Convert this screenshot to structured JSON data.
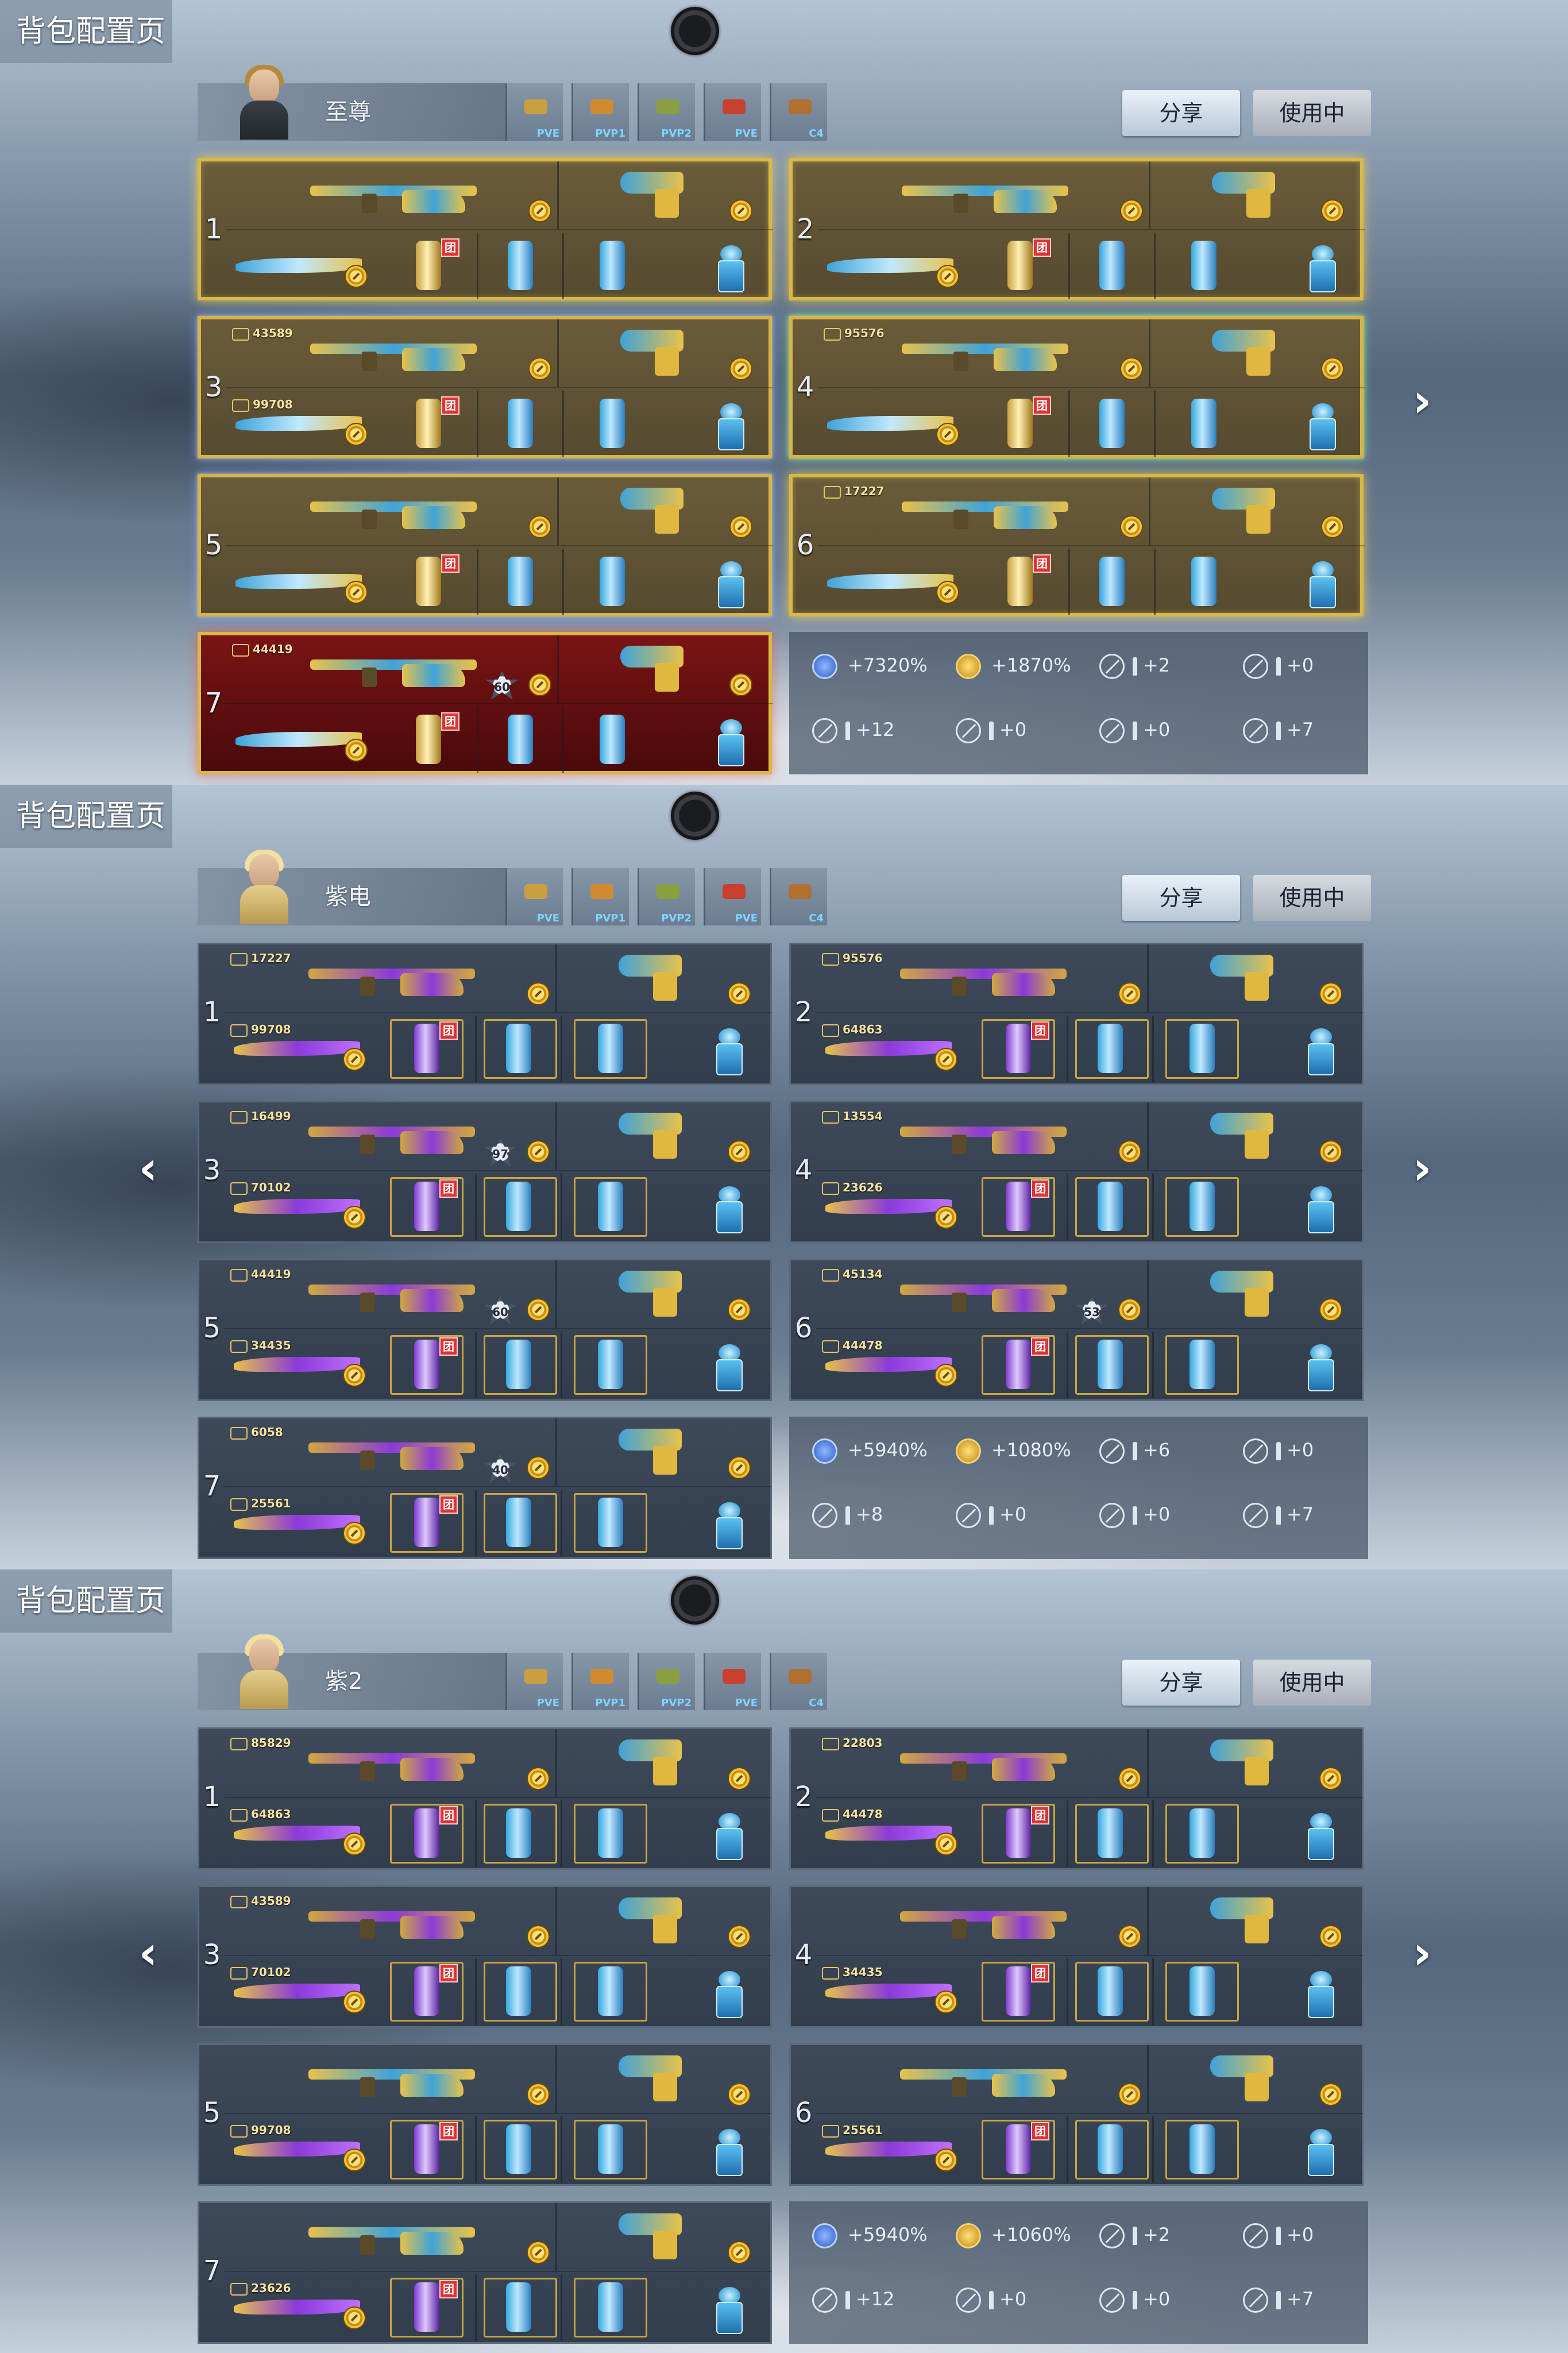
{
  "colors": {
    "gold": "#d9b843",
    "blue_accent": "#36a8e0",
    "purple": "#7e3bd0",
    "team_red": "#dd3333"
  },
  "pages": [
    {
      "title": "背包配置页",
      "loadout_name": "至尊",
      "modes": [
        {
          "label": "PVE",
          "icon": "pve-icon"
        },
        {
          "label": "PVP1",
          "icon": "pvp1-icon"
        },
        {
          "label": "PVP2",
          "icon": "pvp2-icon"
        },
        {
          "label": "PVE",
          "icon": "pve-icon"
        },
        {
          "label": "C4",
          "icon": "c4-icon"
        }
      ],
      "share_label": "分享",
      "using_label": "使用中",
      "has_prev": false,
      "has_next": true,
      "slots": [
        {
          "num": "1",
          "style": "gold",
          "badge_top": "",
          "badge_bottom": "",
          "star": ""
        },
        {
          "num": "2",
          "style": "gold",
          "badge_top": "",
          "badge_bottom": "",
          "star": ""
        },
        {
          "num": "3",
          "style": "gold-blue",
          "badge_top": "43589",
          "badge_bottom": "99708",
          "star": ""
        },
        {
          "num": "4",
          "style": "gold-green",
          "badge_top": "95576",
          "badge_bottom": "",
          "star": ""
        },
        {
          "num": "5",
          "style": "gold-blue",
          "badge_top": "",
          "badge_bottom": "",
          "star": ""
        },
        {
          "num": "6",
          "style": "gold",
          "badge_top": "17227",
          "badge_bottom": "",
          "star": ""
        },
        {
          "num": "7",
          "style": "red",
          "badge_top": "44419",
          "badge_bottom": "",
          "star": "60"
        }
      ],
      "stats": {
        "exp": "+7320%",
        "gold": "+1870%",
        "s1": "+2",
        "s2": "+0",
        "s3": "+12",
        "s4": "+0",
        "s5": "+0",
        "s6": "+7"
      }
    },
    {
      "title": "背包配置页",
      "loadout_name": "紫电",
      "modes": [
        {
          "label": "PVE",
          "icon": "pve-icon"
        },
        {
          "label": "PVP1",
          "icon": "pvp1-icon"
        },
        {
          "label": "PVP2",
          "icon": "pvp2-icon"
        },
        {
          "label": "PVE",
          "icon": "pve-icon"
        },
        {
          "label": "C4",
          "icon": "c4-icon"
        }
      ],
      "share_label": "分享",
      "using_label": "使用中",
      "has_prev": true,
      "has_next": true,
      "slots": [
        {
          "num": "1",
          "style": "plain",
          "badge_top": "17227",
          "badge_bottom": "99708",
          "star": ""
        },
        {
          "num": "2",
          "style": "plain",
          "badge_top": "95576",
          "badge_bottom": "64863",
          "star": ""
        },
        {
          "num": "3",
          "style": "plain",
          "badge_top": "16499",
          "badge_bottom": "70102",
          "star": "97"
        },
        {
          "num": "4",
          "style": "plain",
          "badge_top": "13554",
          "badge_bottom": "23626",
          "star": ""
        },
        {
          "num": "5",
          "style": "plain",
          "badge_top": "44419",
          "badge_bottom": "34435",
          "star": "60"
        },
        {
          "num": "6",
          "style": "plain",
          "badge_top": "45134",
          "badge_bottom": "44478",
          "star": "53"
        },
        {
          "num": "7",
          "style": "plain",
          "badge_top": "6058",
          "badge_bottom": "25561",
          "star": "40"
        }
      ],
      "stats": {
        "exp": "+5940%",
        "gold": "+1080%",
        "s1": "+6",
        "s2": "+0",
        "s3": "+8",
        "s4": "+0",
        "s5": "+0",
        "s6": "+7"
      }
    },
    {
      "title": "背包配置页",
      "loadout_name": "紫2",
      "modes": [
        {
          "label": "PVE",
          "icon": "pve-icon"
        },
        {
          "label": "PVP1",
          "icon": "pvp1-icon"
        },
        {
          "label": "PVP2",
          "icon": "pvp2-icon"
        },
        {
          "label": "PVE",
          "icon": "pve-icon"
        },
        {
          "label": "C4",
          "icon": "c4-icon"
        }
      ],
      "share_label": "分享",
      "using_label": "使用中",
      "has_prev": true,
      "has_next": true,
      "slots": [
        {
          "num": "1",
          "style": "plain",
          "badge_top": "85829",
          "badge_bottom": "64863",
          "star": ""
        },
        {
          "num": "2",
          "style": "plain",
          "badge_top": "22803",
          "badge_bottom": "44478",
          "star": ""
        },
        {
          "num": "3",
          "style": "plain",
          "badge_top": "43589",
          "badge_bottom": "70102",
          "star": ""
        },
        {
          "num": "4",
          "style": "plain",
          "badge_top": "",
          "badge_bottom": "34435",
          "star": ""
        },
        {
          "num": "5",
          "style": "plain",
          "badge_top": "",
          "badge_bottom": "99708",
          "star": ""
        },
        {
          "num": "6",
          "style": "plain",
          "badge_top": "",
          "badge_bottom": "25561",
          "star": ""
        },
        {
          "num": "7",
          "style": "plain",
          "badge_top": "",
          "badge_bottom": "23626",
          "star": ""
        }
      ],
      "stats": {
        "exp": "+5940%",
        "gold": "+1060%",
        "s1": "+2",
        "s2": "+0",
        "s3": "+12",
        "s4": "+0",
        "s5": "+0",
        "s6": "+7"
      }
    }
  ]
}
